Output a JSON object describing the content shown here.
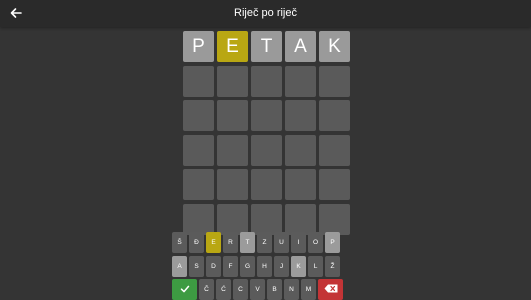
{
  "header": {
    "title": "Riječ po riječ",
    "back_icon": "arrow-left-icon"
  },
  "board": {
    "rows": [
      [
        {
          "letter": "P",
          "state": "absent"
        },
        {
          "letter": "E",
          "state": "present"
        },
        {
          "letter": "T",
          "state": "absent"
        },
        {
          "letter": "A",
          "state": "absent"
        },
        {
          "letter": "K",
          "state": "absent"
        }
      ],
      [
        {
          "letter": "",
          "state": "empty"
        },
        {
          "letter": "",
          "state": "empty"
        },
        {
          "letter": "",
          "state": "empty"
        },
        {
          "letter": "",
          "state": "empty"
        },
        {
          "letter": "",
          "state": "empty"
        }
      ],
      [
        {
          "letter": "",
          "state": "empty"
        },
        {
          "letter": "",
          "state": "empty"
        },
        {
          "letter": "",
          "state": "empty"
        },
        {
          "letter": "",
          "state": "empty"
        },
        {
          "letter": "",
          "state": "empty"
        }
      ],
      [
        {
          "letter": "",
          "state": "empty"
        },
        {
          "letter": "",
          "state": "empty"
        },
        {
          "letter": "",
          "state": "empty"
        },
        {
          "letter": "",
          "state": "empty"
        },
        {
          "letter": "",
          "state": "empty"
        }
      ],
      [
        {
          "letter": "",
          "state": "empty"
        },
        {
          "letter": "",
          "state": "empty"
        },
        {
          "letter": "",
          "state": "empty"
        },
        {
          "letter": "",
          "state": "empty"
        },
        {
          "letter": "",
          "state": "empty"
        }
      ],
      [
        {
          "letter": "",
          "state": "empty"
        },
        {
          "letter": "",
          "state": "empty"
        },
        {
          "letter": "",
          "state": "empty"
        },
        {
          "letter": "",
          "state": "empty"
        },
        {
          "letter": "",
          "state": "empty"
        }
      ]
    ]
  },
  "keyboard": {
    "rows": [
      [
        {
          "label": "Š",
          "state": "normal"
        },
        {
          "label": "Đ",
          "state": "normal"
        },
        {
          "label": "E",
          "state": "present"
        },
        {
          "label": "R",
          "state": "normal"
        },
        {
          "label": "T",
          "state": "absent"
        },
        {
          "label": "Z",
          "state": "normal"
        },
        {
          "label": "U",
          "state": "normal"
        },
        {
          "label": "I",
          "state": "normal"
        },
        {
          "label": "O",
          "state": "normal"
        },
        {
          "label": "P",
          "state": "absent"
        }
      ],
      [
        {
          "label": "A",
          "state": "absent"
        },
        {
          "label": "S",
          "state": "normal"
        },
        {
          "label": "D",
          "state": "normal"
        },
        {
          "label": "F",
          "state": "normal"
        },
        {
          "label": "G",
          "state": "normal"
        },
        {
          "label": "H",
          "state": "normal"
        },
        {
          "label": "J",
          "state": "normal"
        },
        {
          "label": "K",
          "state": "absent"
        },
        {
          "label": "L",
          "state": "normal"
        },
        {
          "label": "Ž",
          "state": "normal"
        }
      ],
      [
        {
          "label": "",
          "state": "enter",
          "icon": "check-icon"
        },
        {
          "label": "Č",
          "state": "normal"
        },
        {
          "label": "Ć",
          "state": "normal"
        },
        {
          "label": "C",
          "state": "normal"
        },
        {
          "label": "V",
          "state": "normal"
        },
        {
          "label": "B",
          "state": "normal"
        },
        {
          "label": "N",
          "state": "normal"
        },
        {
          "label": "M",
          "state": "normal"
        },
        {
          "label": "",
          "state": "del",
          "icon": "backspace-icon"
        }
      ]
    ]
  },
  "colors": {
    "present": "#b9a713",
    "absent": "#9a9a9a",
    "empty": "#5a5a5a",
    "enter": "#3d9b42",
    "delete": "#c33436"
  }
}
